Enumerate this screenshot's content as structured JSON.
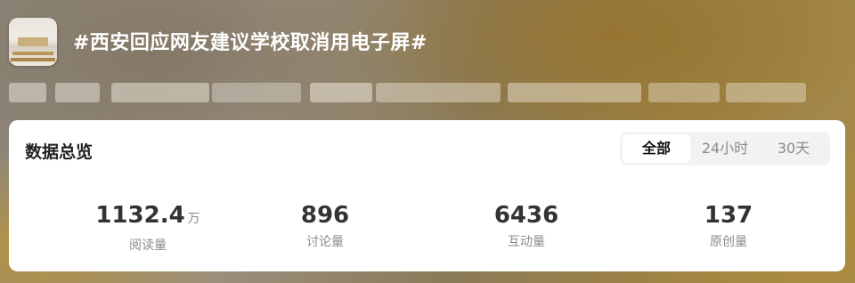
{
  "topic": {
    "title": "#西安回应网友建议学校取消用电子屏#"
  },
  "overview": {
    "title": "数据总览",
    "tabs": [
      {
        "label": "全部",
        "active": true
      },
      {
        "label": "24小时",
        "active": false
      },
      {
        "label": "30天",
        "active": false
      }
    ],
    "stats": [
      {
        "value": "1132.4",
        "unit": "万",
        "label": "阅读量"
      },
      {
        "value": "896",
        "unit": "",
        "label": "讨论量"
      },
      {
        "value": "6436",
        "unit": "",
        "label": "互动量"
      },
      {
        "value": "137",
        "unit": "",
        "label": "原创量"
      }
    ]
  },
  "colors": {
    "card_bg": "#ffffff",
    "title_text": "#ffffff",
    "value_text": "#333333",
    "label_text": "#8a8a8a"
  }
}
